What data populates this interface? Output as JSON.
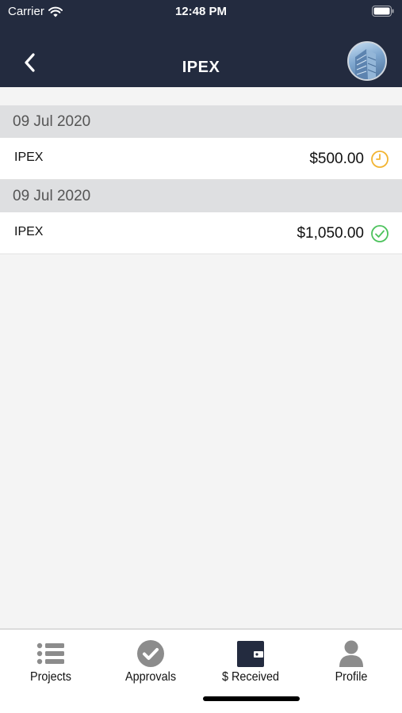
{
  "status_bar": {
    "carrier": "Carrier",
    "time": "12:48 PM",
    "wifi_icon": "wifi-icon",
    "battery_icon": "battery-icon"
  },
  "nav": {
    "title": "IPEX",
    "back_icon": "chevron-left-icon",
    "avatar": "avatar"
  },
  "transactions": [
    {
      "date": "09 Jul 2020",
      "name": "IPEX",
      "amount": "$500.00",
      "status_icon": "clock-icon",
      "status_color": "#f2b431"
    },
    {
      "date": "09 Jul 2020",
      "name": "IPEX",
      "amount": "$1,050.00",
      "status_icon": "check-circle-icon",
      "status_color": "#4cc25c"
    }
  ],
  "tabs": [
    {
      "label": "Projects",
      "icon": "list-icon"
    },
    {
      "label": "Approvals",
      "icon": "check-badge-icon"
    },
    {
      "label": "$ Received",
      "icon": "wallet-icon"
    },
    {
      "label": "Profile",
      "icon": "user-icon"
    }
  ],
  "colors": {
    "header_bg": "#232b3f",
    "section_bg": "#dedfe1",
    "active_tab": "#232b3f",
    "inactive_tab": "#8c8c8c"
  }
}
